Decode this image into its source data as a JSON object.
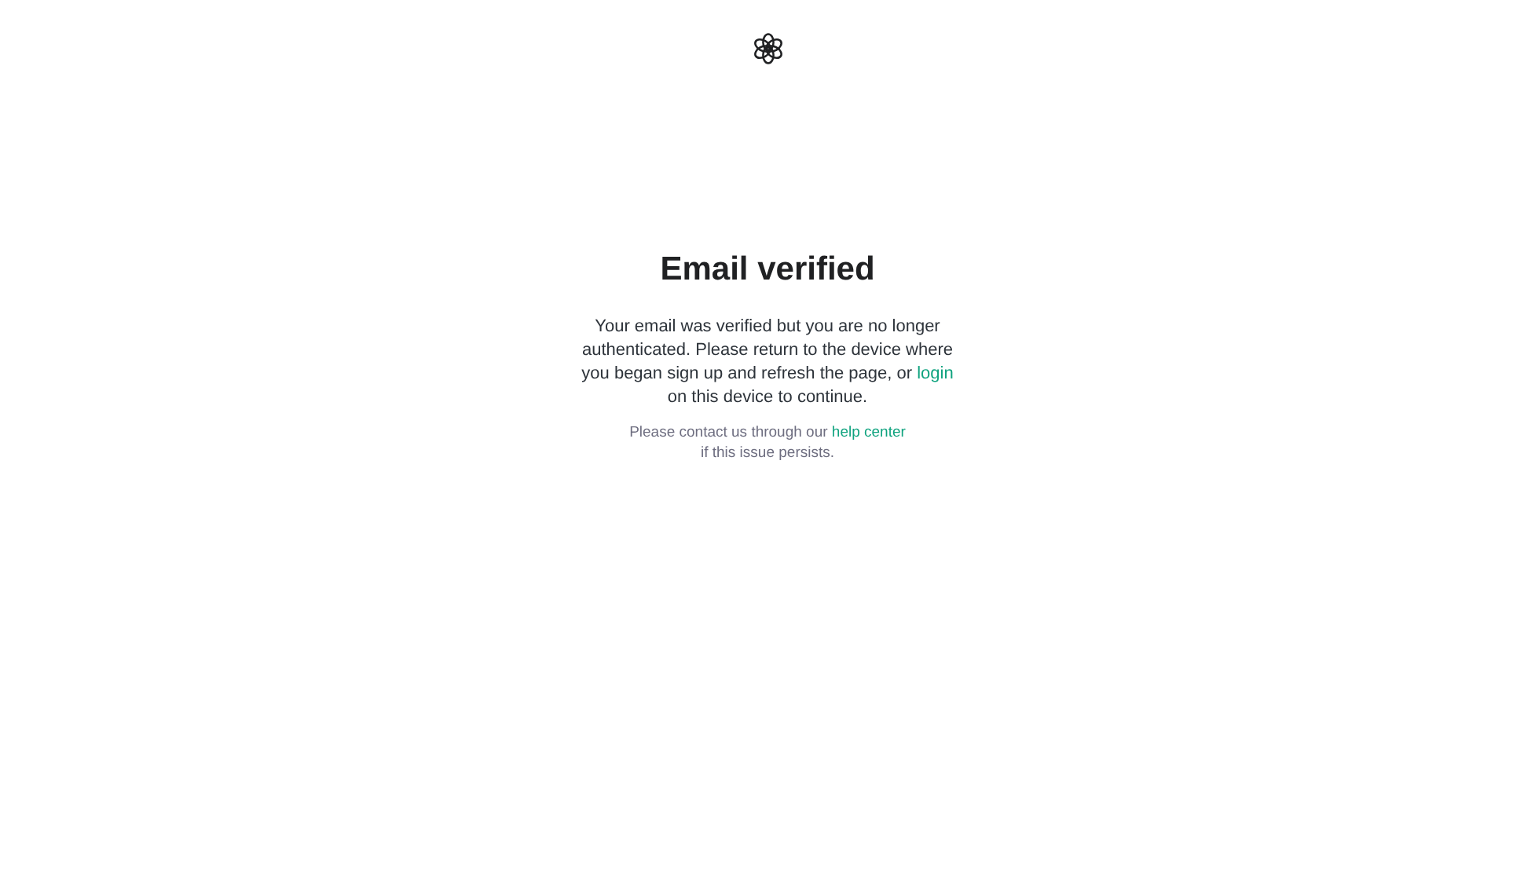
{
  "heading": "Email verified",
  "message": {
    "before": "Your email was verified but you are no longer authenticated. Please return to the device where you began sign up and refresh the page, or ",
    "link": "login",
    "after": " on this device to continue."
  },
  "help": {
    "before": "Please contact us through our ",
    "link": "help center",
    "after": "if this issue persists."
  }
}
